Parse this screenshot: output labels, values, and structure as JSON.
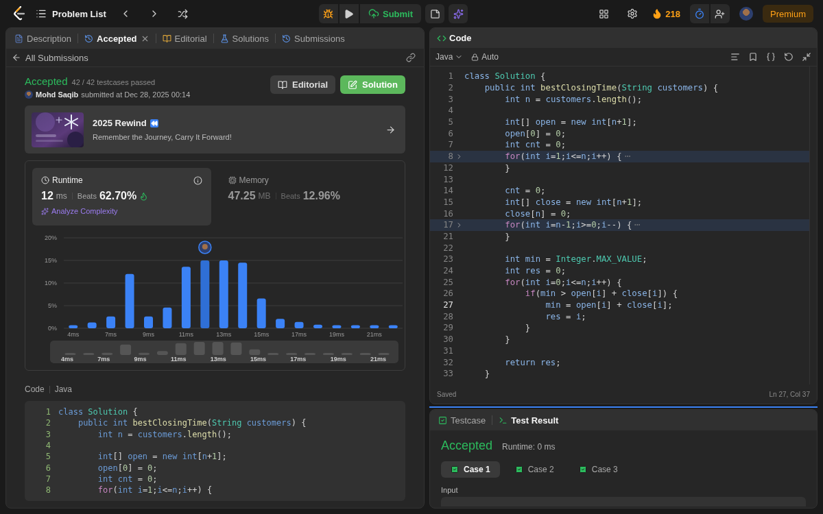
{
  "top_bar": {
    "problem_list": "Problem List",
    "submit": "Submit",
    "streak": "218",
    "premium": "Premium"
  },
  "left_tabs": [
    {
      "label": "Description",
      "selected": false,
      "closable": false
    },
    {
      "label": "Accepted",
      "selected": true,
      "closable": true
    },
    {
      "label": "Editorial",
      "selected": false,
      "closable": false
    },
    {
      "label": "Solutions",
      "selected": false,
      "closable": false
    },
    {
      "label": "Submissions",
      "selected": false,
      "closable": false
    }
  ],
  "back_link": "All Submissions",
  "submission": {
    "status": "Accepted",
    "testcases": "42 / 42 testcases passed",
    "author": "Mohd Saqib",
    "submitted": "submitted at Dec 28, 2025 00:14",
    "buttons": [
      {
        "label": "Editorial",
        "kind": "secondary"
      },
      {
        "label": "Solution",
        "kind": "primary"
      }
    ]
  },
  "banner": {
    "title": "2025 Rewind",
    "subtitle": "Remember the Journey, Carry It Forward!"
  },
  "stats": [
    {
      "label": "Runtime",
      "value": "12",
      "unit": "ms",
      "beats_label": "Beats",
      "beats": "62.70%",
      "selected": true,
      "link": "Analyze Complexity"
    },
    {
      "label": "Memory",
      "value": "47.25",
      "unit": "MB",
      "beats_label": "Beats",
      "beats": "12.96%",
      "selected": false
    }
  ],
  "chart_data": {
    "type": "bar",
    "grid": true,
    "ylim": [
      0,
      20
    ],
    "yticks": [
      {
        "value": 0,
        "label": "0%"
      },
      {
        "value": 5,
        "label": "5%"
      },
      {
        "value": 10,
        "label": "10%"
      },
      {
        "value": 15,
        "label": "15%"
      },
      {
        "value": 20,
        "label": "20%"
      }
    ],
    "categories": [
      "4ms",
      null,
      "7ms",
      null,
      "9ms",
      null,
      "11ms",
      null,
      "13ms",
      null,
      "15ms",
      null,
      "17ms",
      null,
      "19ms",
      null,
      "21ms",
      null
    ],
    "series": [
      {
        "color": "#3b82f6",
        "values": [
          0.7,
          1.3,
          2.6,
          12,
          2.6,
          4.6,
          13.6,
          null,
          15,
          14.5,
          6.6,
          2.1,
          1.4,
          0.8,
          0.7,
          0.7,
          0.7,
          0.7
        ]
      },
      {
        "color": "#2f6fd6",
        "values": [
          null,
          null,
          null,
          null,
          null,
          null,
          null,
          15,
          null,
          null,
          null,
          null,
          null,
          null,
          null,
          null,
          null,
          null
        ]
      }
    ]
  },
  "overview": {
    "labels": [
      "4ms",
      "7ms",
      "9ms",
      "11ms",
      "13ms",
      "15ms",
      "17ms",
      "19ms",
      "21ms"
    ],
    "level": 1
  },
  "code_preview": {
    "label": "Code",
    "language": "Java",
    "lines": [
      {
        "n": "1",
        "text": "class Solution {"
      },
      {
        "n": "2",
        "text": "    public int bestClosingTime(String customers) {"
      },
      {
        "n": "3",
        "text": "        int n = customers.length();"
      },
      {
        "n": "4"
      },
      {
        "n": "5",
        "text": "        int[] open = new int[n+1];"
      },
      {
        "n": "6",
        "text": "        open[0] = 0;"
      },
      {
        "n": "7",
        "text": "        int cnt = 0;"
      },
      {
        "n": "8",
        "text": "        for(int i=1;i<=n;i++) {"
      }
    ]
  },
  "editor": {
    "title": "Code",
    "language": "Java",
    "mode": "Auto",
    "status": "Saved",
    "cursor": "Ln 27, Col 37",
    "lines": [
      {
        "n": "1",
        "text": "class Solution {"
      },
      {
        "n": "2",
        "text": "    public int bestClosingTime(String customers) {"
      },
      {
        "n": "3",
        "text": "        int n = customers.length();"
      },
      {
        "n": "4"
      },
      {
        "n": "5",
        "text": "        int[] open = new int[n+1];"
      },
      {
        "n": "6",
        "text": "        open[0] = 0;"
      },
      {
        "n": "7",
        "text": "        int cnt = 0;"
      },
      {
        "n": "8",
        "collapsed": true,
        "text": "        for(int i=1;i<=n;i++) {"
      },
      {
        "n": "12",
        "text": "        }"
      },
      {
        "n": "13"
      },
      {
        "n": "14",
        "text": "        cnt = 0;"
      },
      {
        "n": "15",
        "text": "        int[] close = new int[n+1];"
      },
      {
        "n": "16",
        "text": "        close[n] = 0;"
      },
      {
        "n": "17",
        "collapsed": true,
        "text": "        for(int i=n-1;i>=0;i--) {"
      },
      {
        "n": "21",
        "text": "        }"
      },
      {
        "n": "22"
      },
      {
        "n": "23",
        "text": "        int min = Integer.MAX_VALUE;"
      },
      {
        "n": "24",
        "text": "        int res = 0;"
      },
      {
        "n": "25",
        "text": "        for(int i=0;i<=n;i++) {"
      },
      {
        "n": "26",
        "text": "            if(min > open[i] + close[i]) {"
      },
      {
        "n": "27",
        "current": true,
        "text": "                min = open[i] + close[i];"
      },
      {
        "n": "28",
        "text": "                res = i;"
      },
      {
        "n": "29",
        "text": "            }"
      },
      {
        "n": "30",
        "text": "        }"
      },
      {
        "n": "31"
      },
      {
        "n": "32",
        "text": "        return res;"
      },
      {
        "n": "33",
        "text": "    }"
      }
    ]
  },
  "result": {
    "tabs": [
      {
        "label": "Testcase",
        "selected": false
      },
      {
        "label": "Test Result",
        "selected": true
      }
    ],
    "status": "Accepted",
    "runtime": "Runtime: 0 ms",
    "cases": [
      {
        "label": "Case 1",
        "selected": true,
        "passed": true
      },
      {
        "label": "Case 2",
        "selected": false,
        "passed": true
      },
      {
        "label": "Case 3",
        "selected": false,
        "passed": true
      }
    ],
    "input_label": "Input"
  }
}
